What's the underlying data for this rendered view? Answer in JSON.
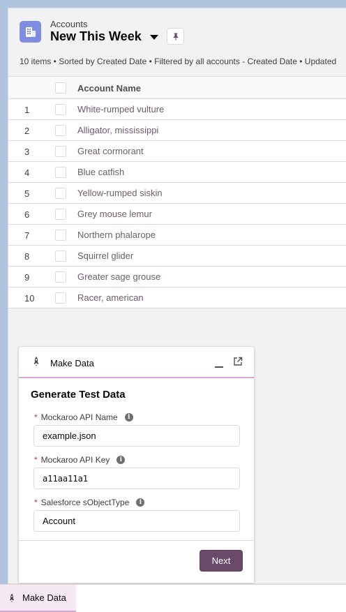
{
  "header": {
    "object_label": "Accounts",
    "list_title": "New This Week",
    "meta": "10 items • Sorted by Created Date • Filtered by all accounts - Created Date • Updated"
  },
  "table": {
    "column_header": "Account Name",
    "rows": [
      {
        "num": "1",
        "name": "White-rumped vulture"
      },
      {
        "num": "2",
        "name": "Alligator, mississippi"
      },
      {
        "num": "3",
        "name": "Great cormorant"
      },
      {
        "num": "4",
        "name": "Blue catfish"
      },
      {
        "num": "5",
        "name": "Yellow-rumped siskin"
      },
      {
        "num": "6",
        "name": "Grey mouse lemur"
      },
      {
        "num": "7",
        "name": "Northern phalarope"
      },
      {
        "num": "8",
        "name": "Squirrel glider"
      },
      {
        "num": "9",
        "name": "Greater sage grouse"
      },
      {
        "num": "10",
        "name": "Racer, american"
      }
    ]
  },
  "panel": {
    "title": "Make Data",
    "heading": "Generate Test Data",
    "fields": [
      {
        "label": "Mockaroo API Name",
        "value": "example.json"
      },
      {
        "label": "Mockaroo API Key",
        "value": "a11aa11a1"
      },
      {
        "label": "Salesforce sObjectType",
        "value": "Account"
      }
    ],
    "required_marker": "*",
    "info_glyph": "i",
    "next_label": "Next"
  },
  "utility_bar": {
    "item_label": "Make Data"
  },
  "colors": {
    "object_icon": "#7f8de1",
    "brand_button": "#6b4968",
    "link_text": "#6b5d69",
    "accent_underline": "#d4a8d4"
  },
  "icons": {
    "object": "building-icon",
    "pin": "pin-icon",
    "dropdown": "caret-down-icon",
    "utility": "rocket-icon",
    "minimize": "minimize-icon",
    "popout": "popout-icon",
    "info": "info-icon"
  }
}
